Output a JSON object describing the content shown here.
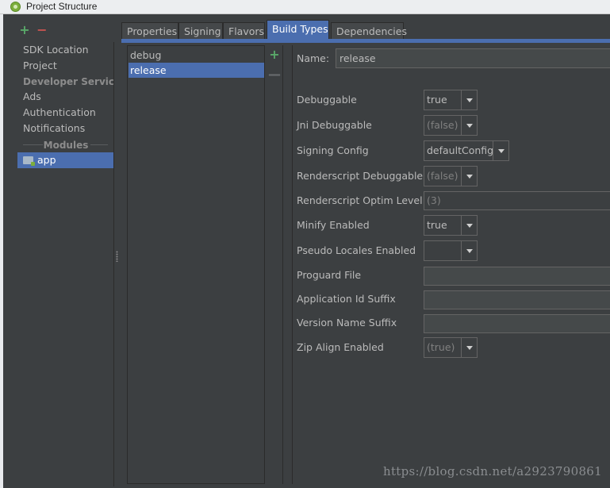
{
  "window": {
    "title": "Project Structure",
    "icon": "android-studio-icon"
  },
  "left_toolbar": {
    "add": "+",
    "remove": "−"
  },
  "left_nav": {
    "items": [
      {
        "label": "SDK Location",
        "type": "item"
      },
      {
        "label": "Project",
        "type": "item"
      },
      {
        "label": "Developer Servic...",
        "type": "group"
      },
      {
        "label": "Ads",
        "type": "item"
      },
      {
        "label": "Authentication",
        "type": "item"
      },
      {
        "label": "Notifications",
        "type": "item"
      }
    ],
    "modules_header": "Modules",
    "modules": [
      {
        "label": "app",
        "selected": true,
        "icon": "module-folder-icon"
      }
    ]
  },
  "tabs": [
    "Properties",
    "Signing",
    "Flavors",
    "Build Types",
    "Dependencies"
  ],
  "active_tab": "Build Types",
  "build_types": {
    "items": [
      "debug",
      "release"
    ],
    "selected": "release",
    "add": "+",
    "remove": "—"
  },
  "form": {
    "name_label": "Name:",
    "name_value": "release",
    "fields": {
      "debuggable": {
        "label": "Debuggable",
        "value": "true"
      },
      "jni_debuggable": {
        "label": "Jni Debuggable",
        "value": "(false)"
      },
      "signing_config": {
        "label": "Signing Config",
        "value": "defaultConfig"
      },
      "renderscript_debuggable": {
        "label": "Renderscript Debuggable",
        "value": "(false)"
      },
      "renderscript_optim": {
        "label": "Renderscript Optim Level",
        "value": "(3)"
      },
      "minify_enabled": {
        "label": "Minify Enabled",
        "value": "true"
      },
      "pseudo_locales": {
        "label": "Pseudo Locales Enabled",
        "value": ""
      },
      "proguard_file": {
        "label": "Proguard File",
        "value": ""
      },
      "app_id_suffix": {
        "label": "Application Id Suffix",
        "value": ""
      },
      "version_name_suffix": {
        "label": "Version Name Suffix",
        "value": ""
      },
      "zip_align": {
        "label": "Zip Align Enabled",
        "value": "(true)"
      }
    }
  },
  "watermark": "https://blog.csdn.net/a2923790861",
  "colors": {
    "selection": "#4b6eaf",
    "background": "#3c3f41",
    "add": "#59a869",
    "remove": "#c75450"
  }
}
